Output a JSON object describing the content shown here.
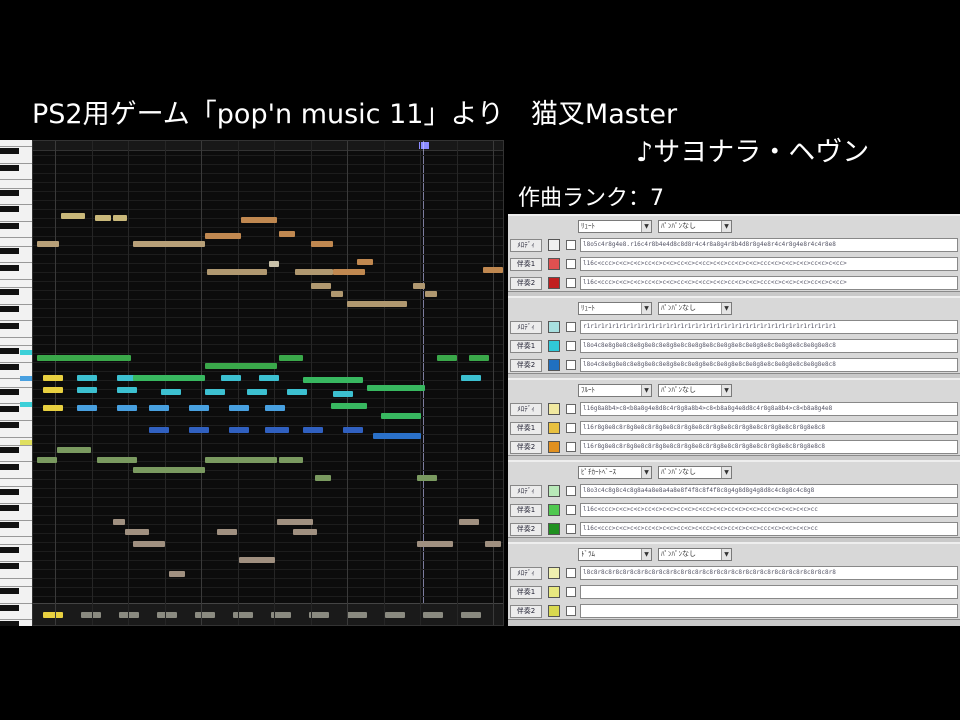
{
  "caption": {
    "line1": "PS2用ゲーム「pop'n music 11」より　猫叉Master",
    "line2": "♪サヨナラ・ヘヴン",
    "rank": "作曲ランク：7"
  },
  "tracks": [
    {
      "instrument": "ﾘｭｰﾄ",
      "setting": "ﾊﾟﾝﾊﾟﾝなし",
      "rows": [
        {
          "button": "ﾒﾛﾃﾞｨ",
          "color": "#f0f0f0",
          "mml": "l8o5c4r8g4e8.r16c4r8b4e4d8c8d8r4c4r8a8g4r8b4d8r8g4e8r4c4r8g4e8r4c4r8e8"
        },
        {
          "button": "伴奏1",
          "color": "#e05050",
          "mml": "l16c<ccc>c<c>c<c>cc<c>c<c>cc<c>c<cc>c<c>cc<c>c<c>ccc<c>c<c>c<c>cc<c>c<cc>"
        },
        {
          "button": "伴奏2",
          "color": "#c02020",
          "mml": "l16c<ccc>c<c>c<c>cc<c>c<c>cc<c>c<cc>c<c>cc<c>c<c>ccc<c>c<c>c<c>cc<c>c<cc>"
        }
      ]
    },
    {
      "instrument": "ﾘｭｰﾄ",
      "setting": "ﾊﾟﾝﾊﾟﾝなし",
      "rows": [
        {
          "button": "ﾒﾛﾃﾞｨ",
          "color": "#a8e0e0",
          "mml": "r1r1r1r1r1r1r1r1r1r1r1r1r1r1r1r1r1r1r1r1r1r1r1r1r1r1r1r1r1r1r1r1r1r1r1"
        },
        {
          "button": "伴奏1",
          "color": "#30c8d8",
          "mml": "l8o4c8e8g8e8c8e8g8e8c8e8g8e8c8e8g8e8c8e8g8e8c8e8g8e8c8e8g8e8c8e8g8e8c8"
        },
        {
          "button": "伴奏2",
          "color": "#2070c0",
          "mml": "l8o4c8e8g8e8c8e8g8e8c8e8g8e8c8e8g8e8c8e8g8e8c8e8g8e8c8e8g8e8c8e8g8e8c8"
        }
      ]
    },
    {
      "instrument": "ﾌﾙｰﾄ",
      "setting": "ﾊﾟﾝﾊﾟﾝなし",
      "rows": [
        {
          "button": "ﾒﾛﾃﾞｨ",
          "color": "#f0e8a0",
          "mml": "l16g8a8b4>c8<b8a8g4e8d8c4r8g8a8b4>c8<b8a8g4e8d8c4r8g8a8b4>c8<b8a8g4e8"
        },
        {
          "button": "伴奏1",
          "color": "#e8c040",
          "mml": "l16r8g8e8c8r8g8e8c8r8g8e8c8r8g8e8c8r8g8e8c8r8g8e8c8r8g8e8c8r8g8e8c8"
        },
        {
          "button": "伴奏2",
          "color": "#e09020",
          "mml": "l16r8g8e8c8r8g8e8c8r8g8e8c8r8g8e8c8r8g8e8c8r8g8e8c8r8g8e8c8r8g8e8c8"
        }
      ]
    },
    {
      "instrument": "ﾋﾟﾁｶｰﾄﾍﾞｰｽ",
      "setting": "ﾊﾟﾝﾊﾟﾝなし",
      "rows": [
        {
          "button": "ﾒﾛﾃﾞｨ",
          "color": "#b8e8b8",
          "mml": "l8o3c4c8g8c4c8g8a4a8e8a4a8e8f4f8c8f4f8c8g4g8d8g4g8d8c4c8g8c4c8g8"
        },
        {
          "button": "伴奏1",
          "color": "#50c850",
          "mml": "l16c<ccc>c<c>c<c>cc<c>c<c>cc<c>c<cc>c<c>cc<c>c<c>ccc<c>c<c>c<c>cc"
        },
        {
          "button": "伴奏2",
          "color": "#209020",
          "mml": "l16c<ccc>c<c>c<c>cc<c>c<c>cc<c>c<cc>c<c>cc<c>c<c>ccc<c>c<c>c<c>cc"
        }
      ]
    },
    {
      "instrument": "ﾄﾞﾗﾑ",
      "setting": "ﾊﾟﾝﾊﾟﾝなし",
      "rows": [
        {
          "button": "ﾒﾛﾃﾞｨ",
          "color": "#f0f0b0",
          "mml": "l8c8r8c8r8c8r8c8r8c8r8c8r8c8r8c8r8c8r8c8r8c8r8c8r8c8r8c8r8c8r8c8r8c8r8"
        },
        {
          "button": "伴奏1",
          "color": "#e8e880",
          "mml": ""
        },
        {
          "button": "伴奏2",
          "color": "#d8d850",
          "mml": ""
        }
      ]
    }
  ]
}
